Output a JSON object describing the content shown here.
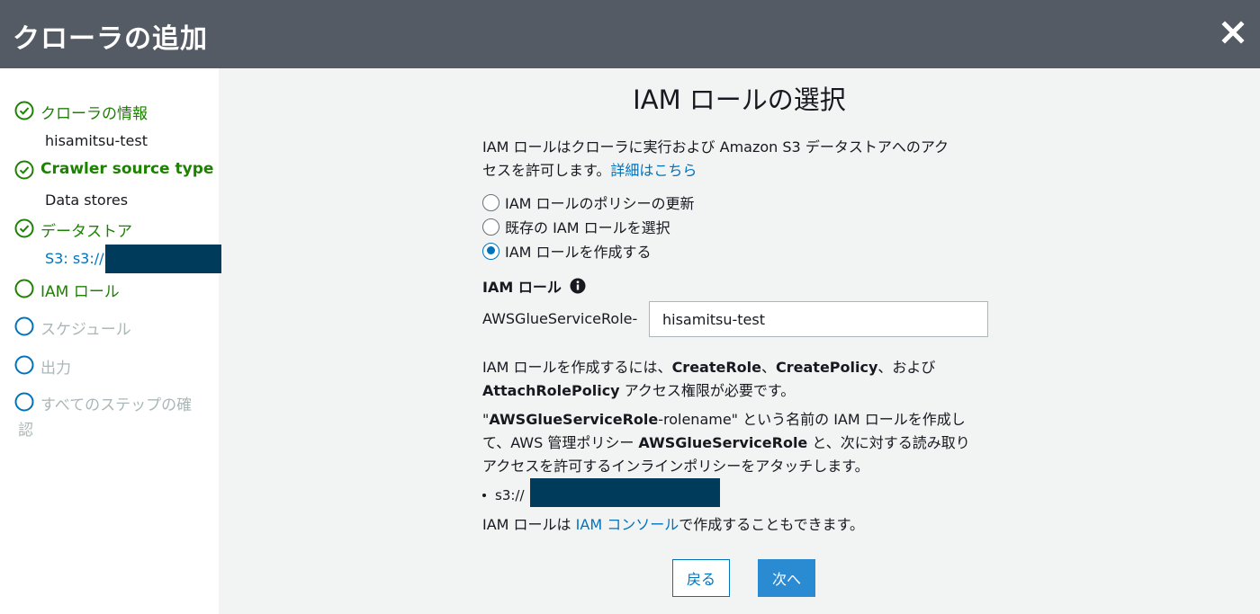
{
  "window": {
    "title": "クローラの追加"
  },
  "steps": [
    {
      "label": "クローラの情報",
      "state": "done",
      "detail": "hisamitsu-test"
    },
    {
      "label": "Crawler source type",
      "state": "done",
      "detail": "Data stores"
    },
    {
      "label": "データストア",
      "state": "done",
      "detail": "S3: s3://"
    },
    {
      "label": "IAM ロール",
      "state": "current"
    },
    {
      "label": "スケジュール",
      "state": "pending"
    },
    {
      "label": "出力",
      "state": "pending"
    },
    {
      "label": "すべてのステップの確",
      "label_line2": "認",
      "state": "pending"
    }
  ],
  "main": {
    "heading": "IAM ロールの選択",
    "intro_line1": "IAM ロールはクローラに実行および Amazon S3 データストアへのアク",
    "intro_line2": "セスを許可します。",
    "intro_link": "詳細はこちら",
    "options": [
      {
        "label": "IAM ロールのポリシーの更新",
        "selected": false
      },
      {
        "label": "既存の IAM ロールを選択",
        "selected": false
      },
      {
        "label": "IAM ロールを作成する",
        "selected": true
      }
    ],
    "field_label": "IAM ロール",
    "prefix": "AWSGlueServiceRole-",
    "input_value": "hisamitsu-test",
    "perm": {
      "p1": "IAM ロールを作成するには、",
      "b1": "CreateRole",
      "p2": "、",
      "b2": "CreatePolicy",
      "p3": "、および",
      "b3": "AttachRolePolicy",
      "p4": " アクセス権限が必要です。"
    },
    "desc": {
      "q1": "\"",
      "b1": "AWSGlueServiceRole",
      "p1": "-rolename\" という名前の IAM ロールを作成し",
      "p2": "て、AWS 管理ポリシー ",
      "b2": "AWSGlueServiceRole",
      "p3": " と、次に対する読み取り",
      "p4": "アクセスを許可するインラインポリシーをアタッチします。"
    },
    "bullet": "s3://",
    "console_p1": "IAM ロールは ",
    "console_link": "IAM コンソール",
    "console_p2": "で作成することもできます。",
    "back_label": "戻る",
    "next_label": "次へ"
  },
  "colors": {
    "header": "#545b64",
    "done": "#1d8102",
    "link": "#0073bb",
    "pending": "#aab7b8",
    "primary": "#2b8bd2",
    "redaction": "#003b5c"
  }
}
